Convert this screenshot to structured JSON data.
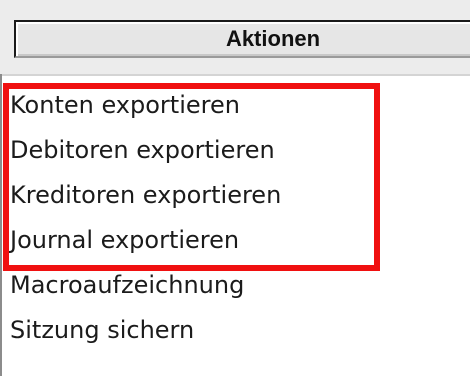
{
  "header": {
    "title": "Aktionen"
  },
  "actions": [
    {
      "label": "Konten exportieren"
    },
    {
      "label": "Debitoren exportieren"
    },
    {
      "label": "Kreditoren exportieren"
    },
    {
      "label": "Journal exportieren"
    },
    {
      "label": "Macroaufzeichnung"
    },
    {
      "label": "Sitzung sichern"
    }
  ],
  "highlight": {
    "color": "#f01010",
    "covers_items": 4
  }
}
